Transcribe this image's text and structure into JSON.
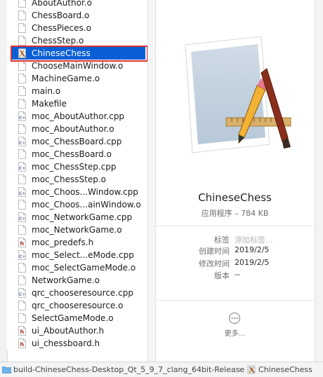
{
  "file_list": {
    "items": [
      {
        "name": "AboutAuthor.o",
        "icon": "document-icon"
      },
      {
        "name": "ChessBoard.o",
        "icon": "document-icon"
      },
      {
        "name": "ChessPieces.o",
        "icon": "document-icon"
      },
      {
        "name": "ChessStep.o",
        "icon": "document-icon"
      },
      {
        "name": "ChineseChess",
        "icon": "app-icon",
        "selected": true
      },
      {
        "name": "ChooseMainWindow.o",
        "icon": "document-icon"
      },
      {
        "name": "MachineGame.o",
        "icon": "document-icon"
      },
      {
        "name": "main.o",
        "icon": "document-icon"
      },
      {
        "name": "Makefile",
        "icon": "document-icon"
      },
      {
        "name": "moc_AboutAuthor.cpp",
        "icon": "cpp-file-icon"
      },
      {
        "name": "moc_AboutAuthor.o",
        "icon": "document-icon"
      },
      {
        "name": "moc_ChessBoard.cpp",
        "icon": "cpp-file-icon"
      },
      {
        "name": "moc_ChessBoard.o",
        "icon": "document-icon"
      },
      {
        "name": "moc_ChessStep.cpp",
        "icon": "cpp-file-icon"
      },
      {
        "name": "moc_ChessStep.o",
        "icon": "document-icon"
      },
      {
        "name": "moc_Choos...Window.cpp",
        "icon": "cpp-file-icon"
      },
      {
        "name": "moc_Choos...ainWindow.o",
        "icon": "document-icon"
      },
      {
        "name": "moc_NetworkGame.cpp",
        "icon": "cpp-file-icon"
      },
      {
        "name": "moc_NetworkGame.o",
        "icon": "document-icon"
      },
      {
        "name": "moc_predefs.h",
        "icon": "h-file-icon"
      },
      {
        "name": "moc_Select...eMode.cpp",
        "icon": "cpp-file-icon"
      },
      {
        "name": "moc_SelectGameMode.o",
        "icon": "document-icon"
      },
      {
        "name": "NetworkGame.o",
        "icon": "document-icon"
      },
      {
        "name": "qrc_chooseresource.cpp",
        "icon": "cpp-file-icon"
      },
      {
        "name": "qrc_chooseresource.o",
        "icon": "document-icon"
      },
      {
        "name": "SelectGameMode.o",
        "icon": "document-icon"
      },
      {
        "name": "ui_AboutAuthor.h",
        "icon": "h-file-icon"
      },
      {
        "name": "ui_chessboard.h",
        "icon": "h-file-icon"
      }
    ]
  },
  "preview": {
    "name": "ChineseChess",
    "kind": "应用程序 – 784 KB",
    "tags_label": "标签",
    "tags_placeholder": "添加标签...",
    "created_label": "创建时间",
    "created_value": "2019/2/5",
    "modified_label": "修改时间",
    "modified_value": "2019/2/5",
    "version_label": "版本",
    "version_value": "--",
    "more_label": "更多..."
  },
  "path_bar": {
    "folder": "build-ChineseChess-Desktop_Qt_5_9_7_clang_64bit-Release",
    "separator": "›",
    "app": "ChineseChess"
  },
  "colors": {
    "selection": "#0b5fd6",
    "highlight_outline": "#e0312f",
    "cpp_badge": "#5b6fb5",
    "h_badge": "#a0332c"
  }
}
